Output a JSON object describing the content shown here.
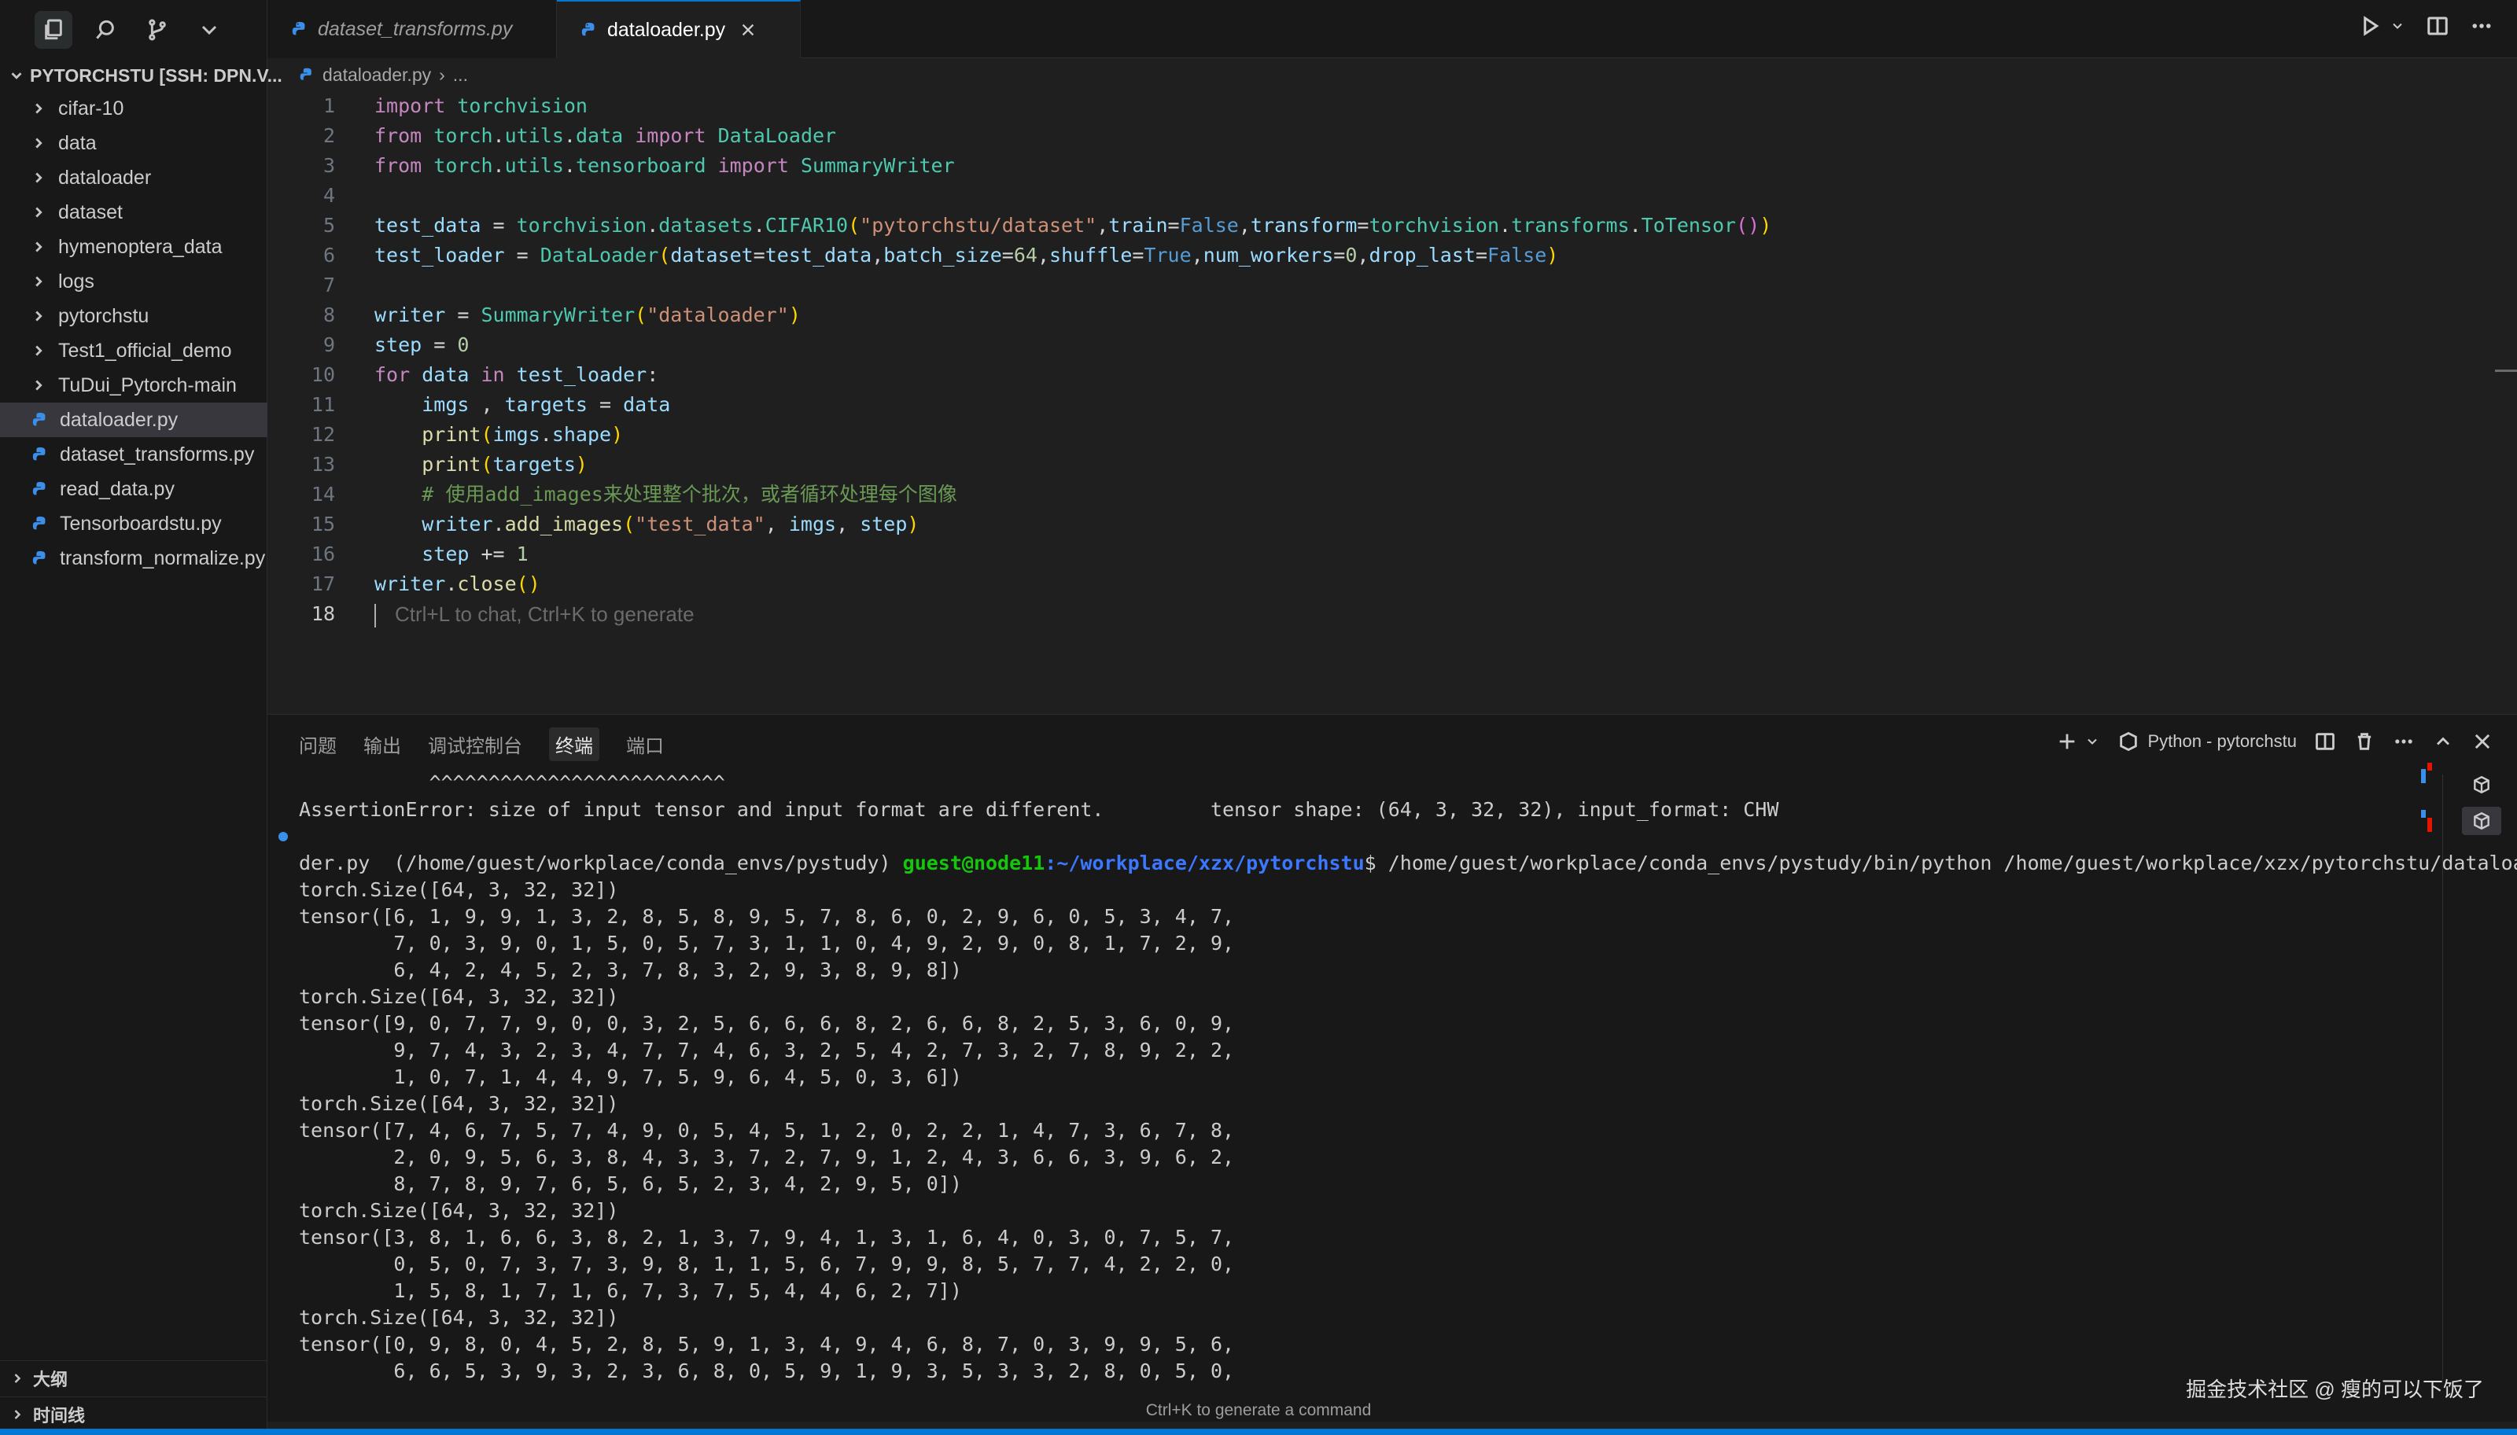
{
  "explorer": {
    "title": "PYTORCHSTU [SSH: DPN.V...",
    "items": [
      {
        "label": "cifar-10",
        "type": "folder"
      },
      {
        "label": "data",
        "type": "folder"
      },
      {
        "label": "dataloader",
        "type": "folder"
      },
      {
        "label": "dataset",
        "type": "folder"
      },
      {
        "label": "hymenoptera_data",
        "type": "folder"
      },
      {
        "label": "logs",
        "type": "folder"
      },
      {
        "label": "pytorchstu",
        "type": "folder"
      },
      {
        "label": "Test1_official_demo",
        "type": "folder"
      },
      {
        "label": "TuDui_Pytorch-main",
        "type": "folder"
      },
      {
        "label": "dataloader.py",
        "type": "file",
        "selected": true
      },
      {
        "label": "dataset_transforms.py",
        "type": "file"
      },
      {
        "label": "read_data.py",
        "type": "file"
      },
      {
        "label": "Tensorboardstu.py",
        "type": "file"
      },
      {
        "label": "transform_normalize.py",
        "type": "file"
      }
    ],
    "outline_label": "大纲",
    "timeline_label": "时间线"
  },
  "tabs": [
    {
      "label": "dataset_transforms.py",
      "active": false
    },
    {
      "label": "dataloader.py",
      "active": true
    }
  ],
  "breadcrumb": {
    "file": "dataloader.py",
    "rest": "..."
  },
  "code": {
    "line_numbers": [
      "1",
      "2",
      "3",
      "4",
      "5",
      "6",
      "7",
      "8",
      "9",
      "10",
      "11",
      "12",
      "13",
      "14",
      "15",
      "16",
      "17",
      "18"
    ],
    "l1": {
      "kw": "import",
      "mod": "torchvision"
    },
    "l2": {
      "kw1": "from",
      "m1": "torch",
      "m2": "utils",
      "m3": "data",
      "kw2": "import",
      "cls": "DataLoader"
    },
    "l3": {
      "kw1": "from",
      "m1": "torch",
      "m2": "utils",
      "m3": "tensorboard",
      "kw2": "import",
      "cls": "SummaryWriter"
    },
    "l5": {
      "v1": "test_data",
      "eq": " = ",
      "m1": "torchvision",
      "m2": "datasets",
      "cls": "CIFAR10",
      "s1": "\"pytorchstu/dataset\"",
      "k1": "train",
      "c1": "False",
      "k2": "transform",
      "m3": "torchvision",
      "m4": "transforms",
      "cls2": "ToTensor"
    },
    "l6": {
      "v1": "test_loader",
      "eq": " = ",
      "cls": "DataLoader",
      "k1": "dataset",
      "a1": "test_data",
      "k2": "batch_size",
      "n1": "64",
      "k3": "shuffle",
      "c1": "True",
      "k4": "num_workers",
      "n2": "0",
      "k5": "drop_last",
      "c2": "False"
    },
    "l8": {
      "v1": "writer",
      "eq": " = ",
      "cls": "SummaryWriter",
      "s1": "\"dataloader\""
    },
    "l9": {
      "v1": "step",
      "eq": " = ",
      "n1": "0"
    },
    "l10": {
      "kw1": "for",
      "v1": "data",
      "kw2": "in",
      "v2": "test_loader",
      "colon": ":"
    },
    "l11": {
      "v1": "imgs",
      "sep": " , ",
      "v2": "targets",
      "eq": " = ",
      "v3": "data"
    },
    "l12": {
      "fn": "print",
      "v1": "imgs",
      "v2": "shape"
    },
    "l13": {
      "fn": "print",
      "v1": "targets"
    },
    "l14": {
      "comment": "# 使用add_images来处理整个批次，或者循环处理每个图像"
    },
    "l15": {
      "v1": "writer",
      "fn": "add_images",
      "s1": "\"test_data\"",
      "v2": "imgs",
      "v3": "step"
    },
    "l16": {
      "v1": "step",
      "op": " += ",
      "n1": "1"
    },
    "l17": {
      "v1": "writer",
      "fn": "close"
    },
    "l18_hint": "Ctrl+L to chat, Ctrl+K to generate"
  },
  "panel": {
    "tabs": [
      "问题",
      "输出",
      "调试控制台",
      "终端",
      "端口"
    ],
    "active_tab": "终端",
    "terminal_name": "Python - pytorchstu"
  },
  "terminal": {
    "lines_before_prompt": [
      "           ^^^^^^^^^^^^^^^^^^^^^^^^^",
      "AssertionError: size of input tensor and input format are different.         tensor shape: (64, 3, 32, 32), input_format: CHW"
    ],
    "prompt_env": "(/home/guest/workplace/conda_envs/pystudy) ",
    "prompt_user": "guest@node11",
    "prompt_path": ":~/workplace/xzx/pytorchstu",
    "prompt_cmd": "$ /home/guest/workplace/conda_envs/pystudy/bin/python /home/guest/workplace/xzx/pytorchstu/dataloa",
    "lines_after_prompt": [
      "der.py",
      "torch.Size([64, 3, 32, 32])",
      "tensor([6, 1, 9, 9, 1, 3, 2, 8, 5, 8, 9, 5, 7, 8, 6, 0, 2, 9, 6, 0, 5, 3, 4, 7,",
      "        7, 0, 3, 9, 0, 1, 5, 0, 5, 7, 3, 1, 1, 0, 4, 9, 2, 9, 0, 8, 1, 7, 2, 9,",
      "        6, 4, 2, 4, 5, 2, 3, 7, 8, 3, 2, 9, 3, 8, 9, 8])",
      "torch.Size([64, 3, 32, 32])",
      "tensor([9, 0, 7, 7, 9, 0, 0, 3, 2, 5, 6, 6, 6, 8, 2, 6, 6, 8, 2, 5, 3, 6, 0, 9,",
      "        9, 7, 4, 3, 2, 3, 4, 7, 7, 4, 6, 3, 2, 5, 4, 2, 7, 3, 2, 7, 8, 9, 2, 2,",
      "        1, 0, 7, 1, 4, 4, 9, 7, 5, 9, 6, 4, 5, 0, 3, 6])",
      "torch.Size([64, 3, 32, 32])",
      "tensor([7, 4, 6, 7, 5, 7, 4, 9, 0, 5, 4, 5, 1, 2, 0, 2, 2, 1, 4, 7, 3, 6, 7, 8,",
      "        2, 0, 9, 5, 6, 3, 8, 4, 3, 3, 7, 2, 7, 9, 1, 2, 4, 3, 6, 6, 3, 9, 6, 2,",
      "        8, 7, 8, 9, 7, 6, 5, 6, 5, 2, 3, 4, 2, 9, 5, 0])",
      "torch.Size([64, 3, 32, 32])",
      "tensor([3, 8, 1, 6, 6, 3, 8, 2, 1, 3, 7, 9, 4, 1, 3, 1, 6, 4, 0, 3, 0, 7, 5, 7,",
      "        0, 5, 0, 7, 3, 7, 3, 9, 8, 1, 1, 5, 6, 7, 9, 9, 8, 5, 7, 7, 4, 2, 2, 0,",
      "        1, 5, 8, 1, 7, 1, 6, 7, 3, 7, 5, 4, 4, 6, 2, 7])",
      "torch.Size([64, 3, 32, 32])",
      "tensor([0, 9, 8, 0, 4, 5, 2, 8, 5, 9, 1, 3, 4, 9, 4, 6, 8, 7, 0, 3, 9, 9, 5, 6,",
      "        6, 6, 5, 3, 9, 3, 2, 3, 6, 8, 0, 5, 9, 1, 9, 3, 5, 3, 3, 2, 8, 0, 5, 0,"
    ]
  },
  "footer_hint": "Ctrl+K to generate a command",
  "watermark": "掘金技术社区 @ 瘦的可以下饭了",
  "colors": {
    "accent": "#0078d4",
    "python_icon": "#3b8eea"
  }
}
